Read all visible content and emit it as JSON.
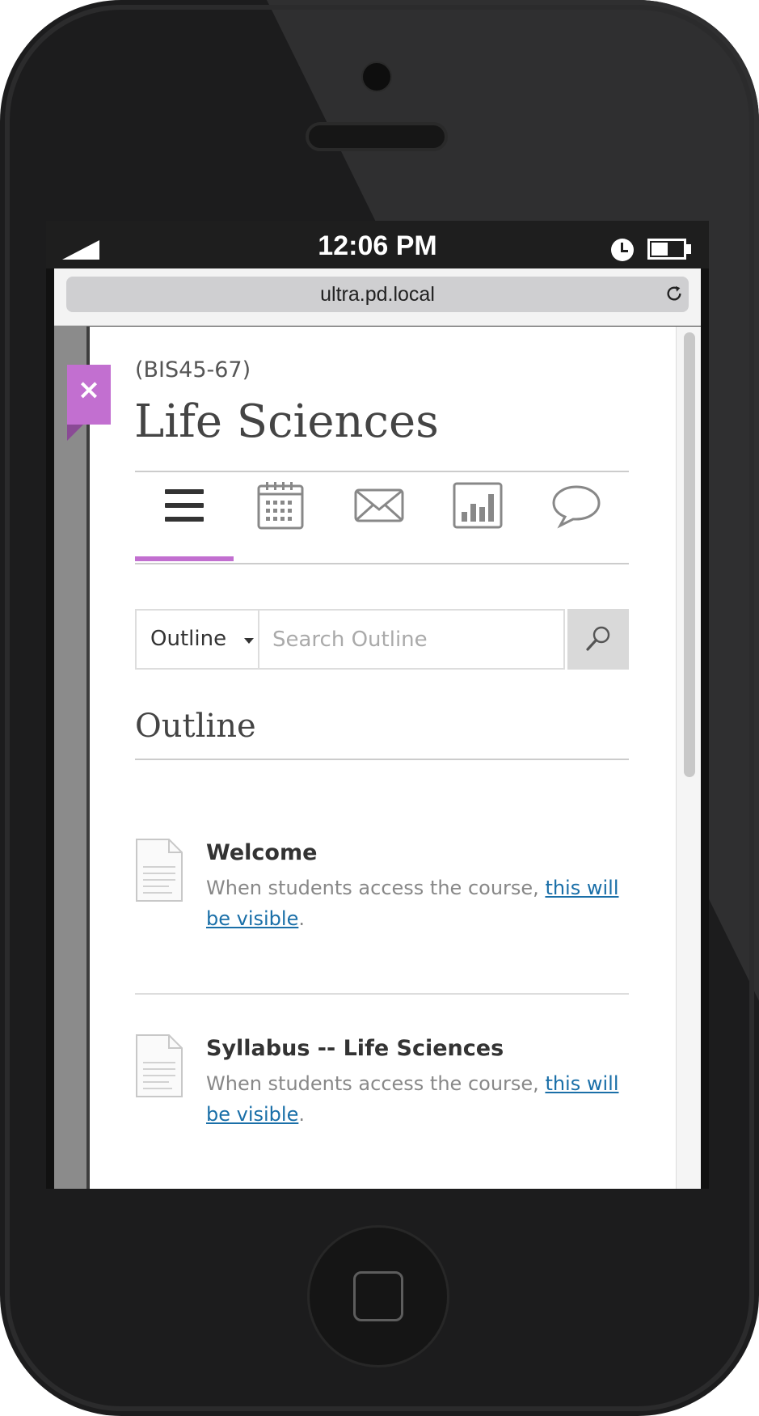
{
  "status_bar": {
    "time": "12:06 PM"
  },
  "browser": {
    "url": "ultra.pd.local"
  },
  "course": {
    "code": "(BIS45-67)",
    "title": "Life Sciences"
  },
  "close_label": "×",
  "tabs": [
    {
      "icon": "outline-menu-icon",
      "active": true
    },
    {
      "icon": "calendar-icon",
      "active": false
    },
    {
      "icon": "messages-envelope-icon",
      "active": false
    },
    {
      "icon": "grades-chart-icon",
      "active": false
    },
    {
      "icon": "discussions-bubble-icon",
      "active": false
    }
  ],
  "filter": {
    "selected": "Outline",
    "search_placeholder": "Search Outline"
  },
  "section_title": "Outline",
  "items": [
    {
      "title": "Welcome",
      "desc_prefix": "When students access the course, ",
      "desc_link": "this will be visible",
      "desc_suffix": "."
    },
    {
      "title": "Syllabus -- Life Sciences",
      "desc_prefix": "When students access the course, ",
      "desc_link": "this will be visible",
      "desc_suffix": "."
    }
  ],
  "colors": {
    "accent": "#c26fd0",
    "link": "#1a6fa8",
    "device": "#1c1c1d"
  }
}
